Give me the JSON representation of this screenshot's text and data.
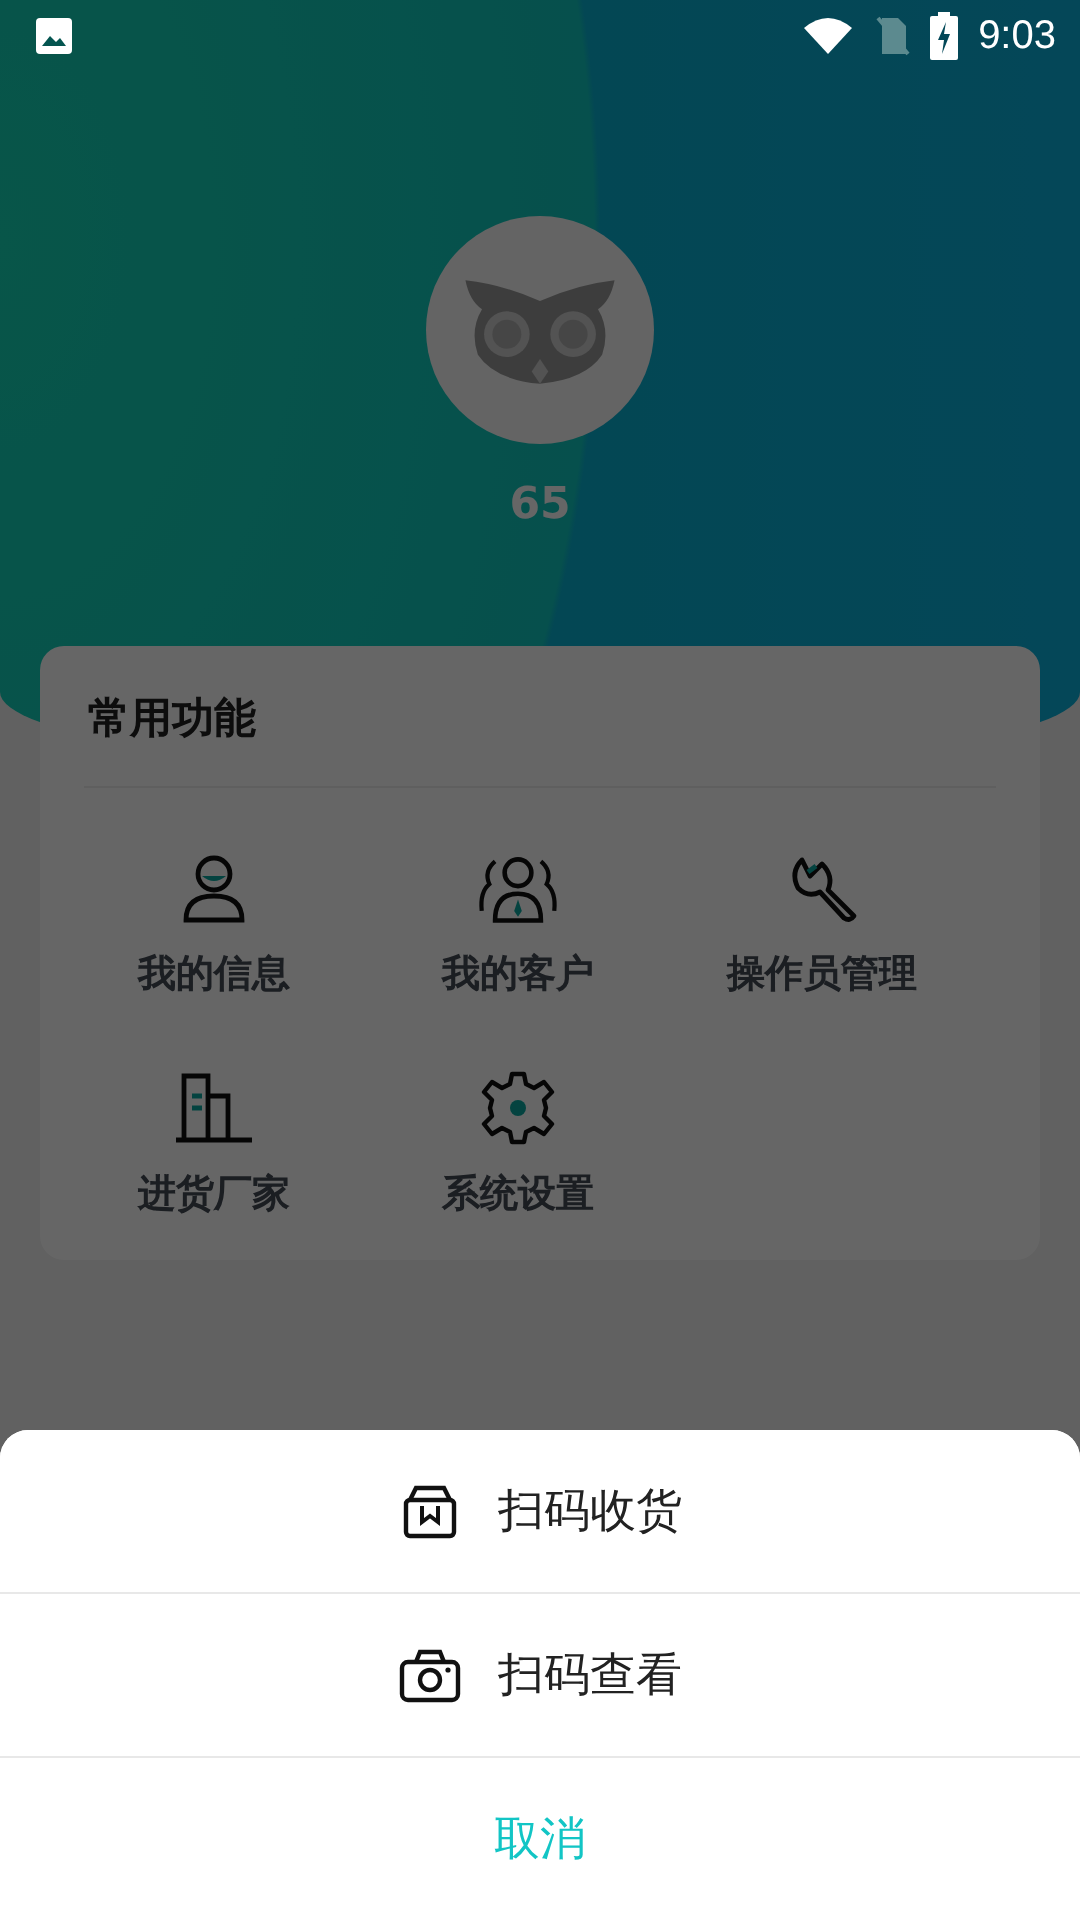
{
  "status_bar": {
    "time": "9:03"
  },
  "profile": {
    "name": "65"
  },
  "functions": {
    "title": "常用功能",
    "items": [
      {
        "label": "我的信息",
        "kind": "person"
      },
      {
        "label": "我的客户",
        "kind": "customers"
      },
      {
        "label": "操作员管理",
        "kind": "wrench"
      },
      {
        "label": "进货厂家",
        "kind": "building"
      },
      {
        "label": "系统设置",
        "kind": "gear"
      }
    ]
  },
  "action_sheet": {
    "options": [
      {
        "label": "扫码收货",
        "kind": "box"
      },
      {
        "label": "扫码查看",
        "kind": "camera"
      }
    ],
    "cancel": "取消"
  }
}
